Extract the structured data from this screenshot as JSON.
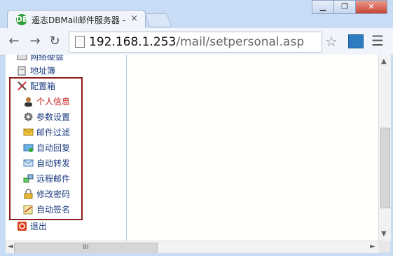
{
  "tab": {
    "favicon": "DB",
    "title": "遥志DBMail邮件服务器 -",
    "close": "×"
  },
  "window_buttons": {
    "minimize": "▁",
    "restore": "❐",
    "close": "✕"
  },
  "toolbar": {
    "back": "←",
    "forward": "→",
    "reload": "↻",
    "url_host": "192.168.1.253",
    "url_path": "/mail/setpersonal.asp",
    "star": "☆",
    "menu": "☰"
  },
  "sidebar": {
    "items": [
      {
        "label": "网络硬盘",
        "icon": "disk-icon"
      },
      {
        "label": "地址簿",
        "icon": "address-book-icon"
      },
      {
        "label": "配置箱",
        "icon": "tools-icon"
      },
      {
        "label": "个人信息",
        "icon": "user-icon"
      },
      {
        "label": "参数设置",
        "icon": "gear-icon"
      },
      {
        "label": "邮件过滤",
        "icon": "mail-filter-icon"
      },
      {
        "label": "自动回复",
        "icon": "auto-reply-icon"
      },
      {
        "label": "自动转发",
        "icon": "auto-forward-icon"
      },
      {
        "label": "远程邮件",
        "icon": "remote-mail-icon"
      },
      {
        "label": "修改密码",
        "icon": "lock-icon"
      },
      {
        "label": "自动签名",
        "icon": "signature-icon"
      },
      {
        "label": "退出",
        "icon": "exit-icon"
      }
    ]
  },
  "scrollbar": {
    "up": "▲",
    "down": "▼",
    "left": "◄",
    "right": "►",
    "grip": "III"
  },
  "colors": {
    "active": "#c21515",
    "link": "#1c3c80",
    "group_border": "#8f1d1d"
  }
}
